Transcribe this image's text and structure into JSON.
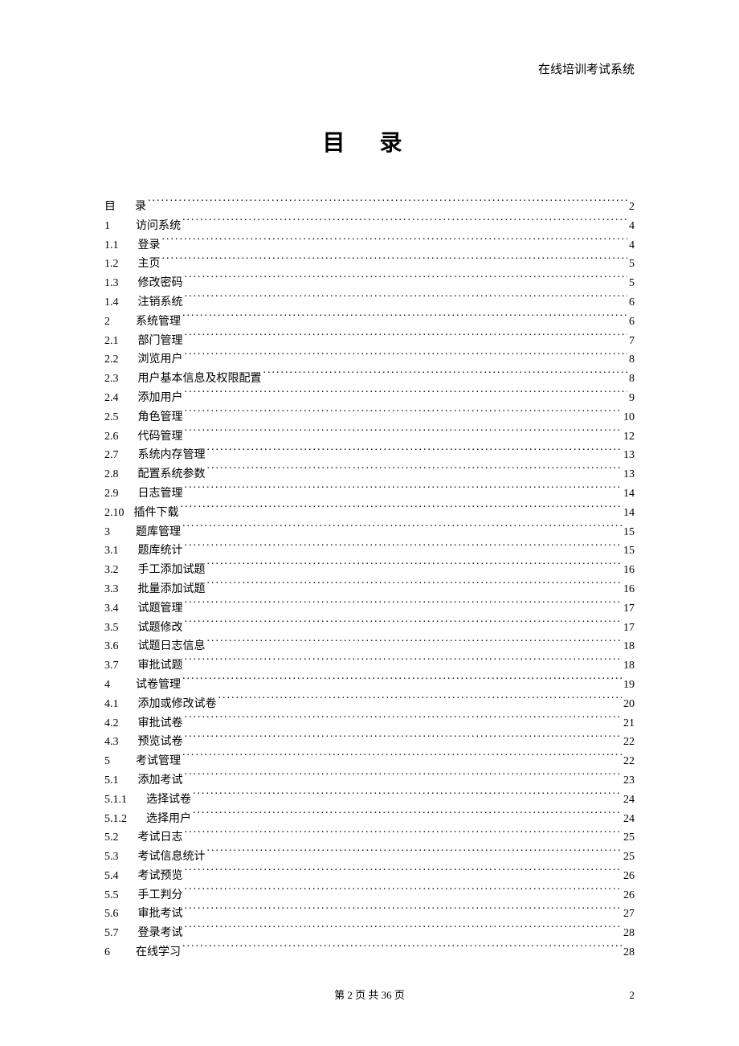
{
  "header": {
    "system_name": "在线培训考试系统"
  },
  "title": "目 录",
  "toc": [
    {
      "num": "目",
      "text": "录",
      "page": "2",
      "level": 0,
      "gap": "gap-0"
    },
    {
      "num": "1",
      "text": "访问系统",
      "page": "4",
      "level": 1,
      "gap": "gap-1"
    },
    {
      "num": "1.1",
      "text": "登录",
      "page": "4",
      "level": 2,
      "gap": "gap-2"
    },
    {
      "num": "1.2",
      "text": "主页",
      "page": "5",
      "level": 2,
      "gap": "gap-2"
    },
    {
      "num": "1.3",
      "text": "修改密码",
      "page": "5",
      "level": 2,
      "gap": "gap-2"
    },
    {
      "num": "1.4",
      "text": "注销系统",
      "page": "6",
      "level": 2,
      "gap": "gap-2"
    },
    {
      "num": "2",
      "text": "系统管理",
      "page": "6",
      "level": 1,
      "gap": "gap-1"
    },
    {
      "num": "2.1",
      "text": "部门管理",
      "page": "7",
      "level": 2,
      "gap": "gap-2"
    },
    {
      "num": "2.2",
      "text": "浏览用户",
      "page": "8",
      "level": 2,
      "gap": "gap-2"
    },
    {
      "num": "2.3",
      "text": "用户基本信息及权限配置",
      "page": "8",
      "level": 2,
      "gap": "gap-2"
    },
    {
      "num": "2.4",
      "text": "添加用户",
      "page": "9",
      "level": 2,
      "gap": "gap-2"
    },
    {
      "num": "2.5",
      "text": "角色管理",
      "page": "10",
      "level": 2,
      "gap": "gap-2"
    },
    {
      "num": "2.6",
      "text": "代码管理",
      "page": "12",
      "level": 2,
      "gap": "gap-2"
    },
    {
      "num": "2.7",
      "text": "系统内存管理",
      "page": "13",
      "level": 2,
      "gap": "gap-2"
    },
    {
      "num": "2.8",
      "text": "配置系统参数",
      "page": "13",
      "level": 2,
      "gap": "gap-2"
    },
    {
      "num": "2.9",
      "text": "日志管理",
      "page": "14",
      "level": 2,
      "gap": "gap-2"
    },
    {
      "num": "2.10",
      "text": "插件下载",
      "page": "14",
      "level": 2,
      "gap": "gap-4"
    },
    {
      "num": "3",
      "text": "题库管理",
      "page": "15",
      "level": 1,
      "gap": "gap-1"
    },
    {
      "num": "3.1",
      "text": "题库统计",
      "page": "15",
      "level": 2,
      "gap": "gap-2"
    },
    {
      "num": "3.2",
      "text": "手工添加试题",
      "page": "16",
      "level": 2,
      "gap": "gap-2"
    },
    {
      "num": "3.3",
      "text": "批量添加试题",
      "page": "16",
      "level": 2,
      "gap": "gap-2"
    },
    {
      "num": "3.4",
      "text": "试题管理",
      "page": "17",
      "level": 2,
      "gap": "gap-2"
    },
    {
      "num": "3.5",
      "text": "试题修改",
      "page": "17",
      "level": 2,
      "gap": "gap-2"
    },
    {
      "num": "3.6",
      "text": "试题日志信息",
      "page": "18",
      "level": 2,
      "gap": "gap-2"
    },
    {
      "num": "3.7",
      "text": "审批试题",
      "page": "18",
      "level": 2,
      "gap": "gap-2"
    },
    {
      "num": "4",
      "text": "试卷管理",
      "page": "19",
      "level": 1,
      "gap": "gap-1"
    },
    {
      "num": "4.1",
      "text": "添加或修改试卷",
      "page": "20",
      "level": 2,
      "gap": "gap-2"
    },
    {
      "num": "4.2",
      "text": "审批试卷",
      "page": "21",
      "level": 2,
      "gap": "gap-2"
    },
    {
      "num": "4.3",
      "text": "预览试卷",
      "page": "22",
      "level": 2,
      "gap": "gap-2"
    },
    {
      "num": "5",
      "text": "考试管理",
      "page": "22",
      "level": 1,
      "gap": "gap-1"
    },
    {
      "num": "5.1",
      "text": "添加考试",
      "page": "23",
      "level": 2,
      "gap": "gap-2"
    },
    {
      "num": "5.1.1",
      "text": "选择试卷",
      "page": "24",
      "level": 3,
      "gap": "gap-3"
    },
    {
      "num": "5.1.2",
      "text": "选择用户",
      "page": "24",
      "level": 3,
      "gap": "gap-3"
    },
    {
      "num": "5.2",
      "text": "考试日志",
      "page": "25",
      "level": 2,
      "gap": "gap-2"
    },
    {
      "num": "5.3",
      "text": "考试信息统计",
      "page": "25",
      "level": 2,
      "gap": "gap-2"
    },
    {
      "num": "5.4",
      "text": "考试预览",
      "page": "26",
      "level": 2,
      "gap": "gap-2"
    },
    {
      "num": "5.5",
      "text": "手工判分",
      "page": "26",
      "level": 2,
      "gap": "gap-2"
    },
    {
      "num": "5.6",
      "text": "审批考试",
      "page": "27",
      "level": 2,
      "gap": "gap-2"
    },
    {
      "num": "5.7",
      "text": "登录考试",
      "page": "28",
      "level": 2,
      "gap": "gap-2"
    },
    {
      "num": "6",
      "text": "在线学习",
      "page": "28",
      "level": 1,
      "gap": "gap-1"
    }
  ],
  "footer": {
    "center": "第 2 页   共 36 页",
    "right": "2"
  }
}
